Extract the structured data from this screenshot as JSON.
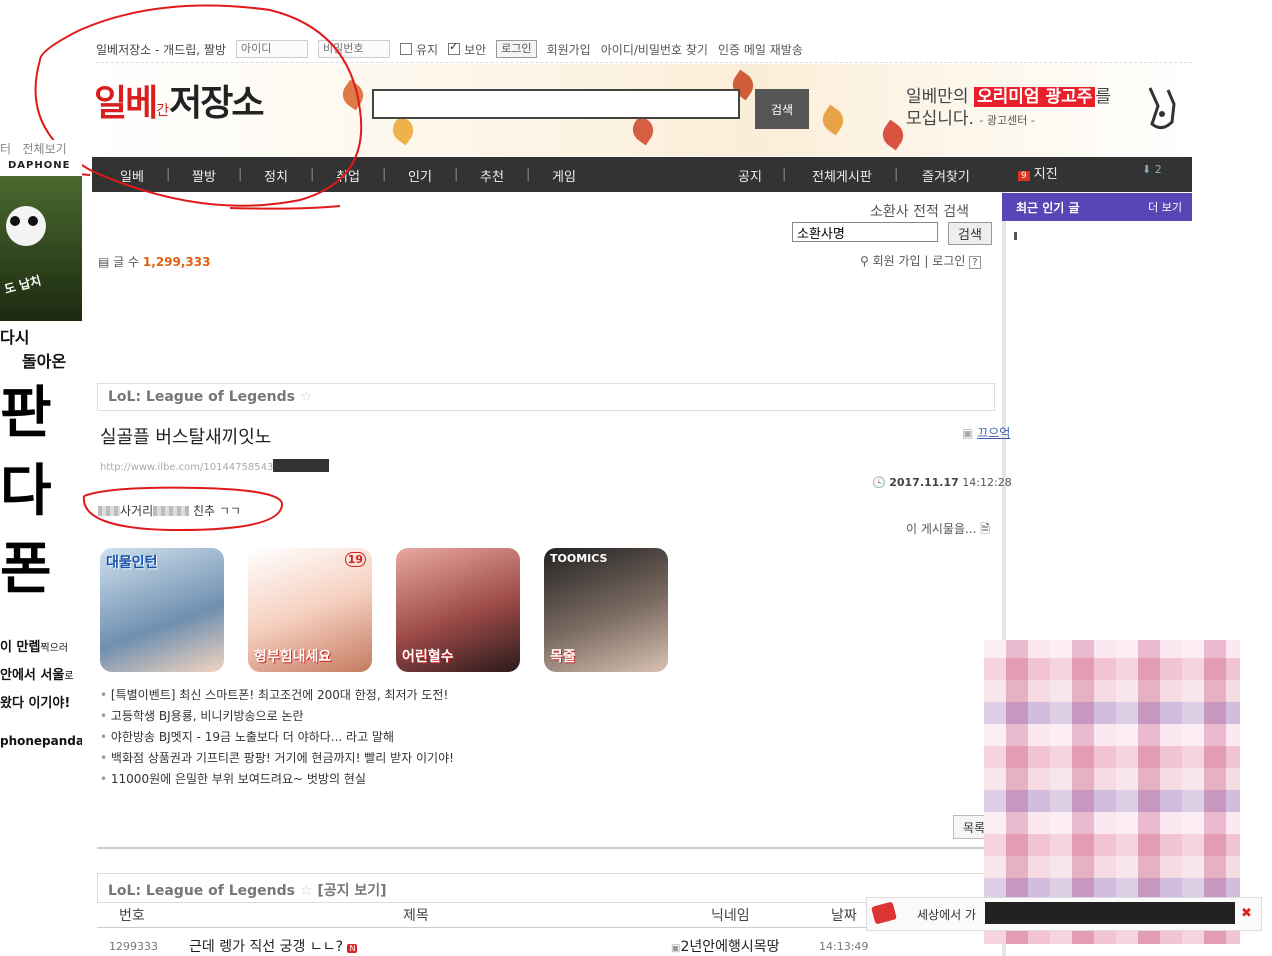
{
  "topbar": {
    "site": "일베저장소 - 개드립, 짤방",
    "id_placeholder": "아이디",
    "pw_placeholder": "비밀번호",
    "keep": "유지",
    "secure": "보안",
    "login": "로그인",
    "signup": "회원가입",
    "find": "아이디/비밀번호 찾기",
    "resend": "인증 메일 재발송"
  },
  "logo": {
    "a": "일베",
    "c": "간",
    "b": "저장소"
  },
  "search": {
    "button": "검색"
  },
  "ad": {
    "line1": "일베만의",
    "highlight": "오리미엄 광고주",
    "suffix": "를",
    "line2": "모십니다.",
    "note": "- 광고센터 -"
  },
  "nav": {
    "left": [
      "일베",
      "짤방",
      "정치",
      "취업",
      "인기",
      "추천",
      "게임"
    ],
    "right": [
      "공지",
      "전체게시판",
      "즐겨찾기"
    ],
    "jijin_badge": "9",
    "jijin": "지진",
    "down_count": "2"
  },
  "sidebar": {
    "popular": "최근 인기 글",
    "more": "더 보기"
  },
  "summoner": {
    "title": "소환사 전적 검색",
    "input": "소환사명",
    "button": "검색"
  },
  "board": {
    "count_label": "글 수",
    "count": "1,299,333",
    "join": "회원 가입",
    "login": "로그인",
    "help": "?",
    "name": "LoL: League of Legends",
    "post_title": "실골플 버스탈새끼잇노",
    "author": "끄으억",
    "url": "http://www.ilbe.com/10144758543",
    "date": "2017.11.17",
    "time": "14:12:28",
    "content_mid": "사거리",
    "content_end": "친추 ㄱㄱ",
    "this_post": "이 게시물을...",
    "list_button": "목록"
  },
  "thumbs": [
    {
      "title": "대물인턴",
      "tag": ""
    },
    {
      "title": "형부힘내세요",
      "tag": "19"
    },
    {
      "title": "어린혈수",
      "tag": ""
    },
    {
      "title": "목줄",
      "tag": "TOOMICS"
    }
  ],
  "ad_links": [
    "[특별이벤트] 최신 스마트폰! 최고조건에 200대 한정, 최저가 도전!",
    "고등학생 BJ용룡, 비니키방송으로 논란",
    "야한방송 BJ멧지 - 19금 노출보다 더 야하다... 라고 말해",
    "백화점 상품권과 기프티콘 팡팡! 거기에 현금까지! 빨리 받자 이기야!",
    "11000원에 은밀한 부위 보여드려요~ 벗방의 현실"
  ],
  "board2": {
    "name": "LoL: League of Legends",
    "notice": "[공지 보기]",
    "col_no": "번호",
    "col_title": "제목",
    "col_nick": "닉네임",
    "col_date": "날짜",
    "row_no": "1299333",
    "row_title": "근데 렝가 직선 궁갱 ㄴㄴ?",
    "row_nick": "2년안에행시목땅",
    "row_time": "14:13:49"
  },
  "leftad": {
    "top1": "터",
    "top2": "전체보기",
    "brand": "DAPHONE",
    "l1": "다시",
    "l2": "돌아온",
    "big1": "판",
    "big2": "다",
    "big3": "폰",
    "s1": "이 만렙",
    "s1b": "찍으러",
    "s2": "안에서 서울",
    "s2b": "로",
    "s3": "왔다 이기야!",
    "url": "phonepanda",
    "panda_tag": "도 납치"
  },
  "floatbar": {
    "text": "세상에서 가",
    "close": "✖"
  }
}
